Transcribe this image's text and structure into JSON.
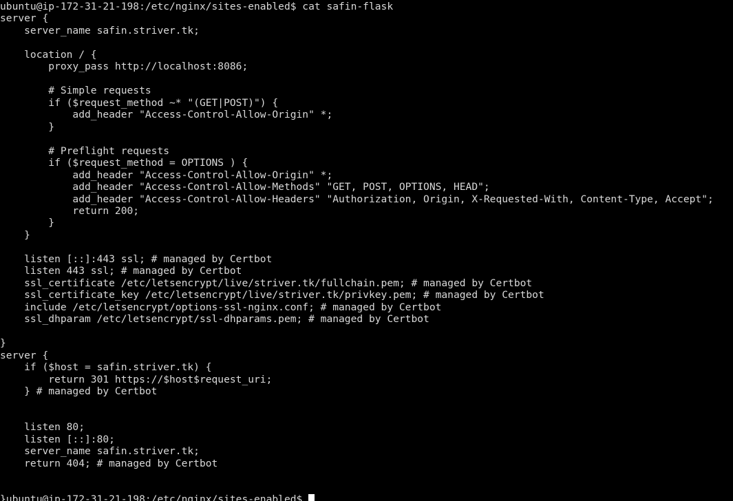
{
  "terminal": {
    "type": "terminal-emulator",
    "background_color": "#000000",
    "foreground_color": "#d9d9d9",
    "cursor_color": "#ffffff",
    "cursor_style": "block",
    "columns": 118,
    "rows": 41,
    "font_family": "monospace",
    "shell_user": "ubuntu",
    "shell_host": "ip-172-31-21-198",
    "working_directory": "/etc/nginx/sites-enabled",
    "command_entered": "cat safin-flask",
    "prompt_top": "ubuntu@ip-172-31-21-198:/etc/nginx/sites-enabled$ cat safin-flask",
    "prompt_bottom": "}ubuntu@ip-172-31-21-198:/etc/nginx/sites-enabled$ ",
    "lines": [
      "ubuntu@ip-172-31-21-198:/etc/nginx/sites-enabled$ cat safin-flask",
      "server {",
      "    server_name safin.striver.tk;",
      "",
      "    location / {",
      "        proxy_pass http://localhost:8086;",
      "",
      "        # Simple requests",
      "        if ($request_method ~* \"(GET|POST)\") {",
      "            add_header \"Access-Control-Allow-Origin\" *;",
      "        }",
      "",
      "        # Preflight requests",
      "        if ($request_method = OPTIONS ) {",
      "            add_header \"Access-Control-Allow-Origin\" *;",
      "            add_header \"Access-Control-Allow-Methods\" \"GET, POST, OPTIONS, HEAD\";",
      "            add_header \"Access-Control-Allow-Headers\" \"Authorization, Origin, X-Requested-With, Content-Type, Accept\";",
      "            return 200;",
      "        }",
      "    }",
      "",
      "    listen [::]:443 ssl; # managed by Certbot",
      "    listen 443 ssl; # managed by Certbot",
      "    ssl_certificate /etc/letsencrypt/live/striver.tk/fullchain.pem; # managed by Certbot",
      "    ssl_certificate_key /etc/letsencrypt/live/striver.tk/privkey.pem; # managed by Certbot",
      "    include /etc/letsencrypt/options-ssl-nginx.conf; # managed by Certbot",
      "    ssl_dhparam /etc/letsencrypt/ssl-dhparams.pem; # managed by Certbot",
      "",
      "}",
      "server {",
      "    if ($host = safin.striver.tk) {",
      "        return 301 https://$host$request_uri;",
      "    } # managed by Certbot",
      "",
      "",
      "    listen 80;",
      "    listen [::]:80;",
      "    server_name safin.striver.tk;",
      "    return 404; # managed by Certbot",
      "",
      ""
    ],
    "final_line_prefix": "}ubuntu@ip-172-31-21-198:/etc/nginx/sites-enabled$ ",
    "cursor": {
      "name": "block-cursor",
      "visible": true,
      "column": 51,
      "row": 41
    }
  }
}
